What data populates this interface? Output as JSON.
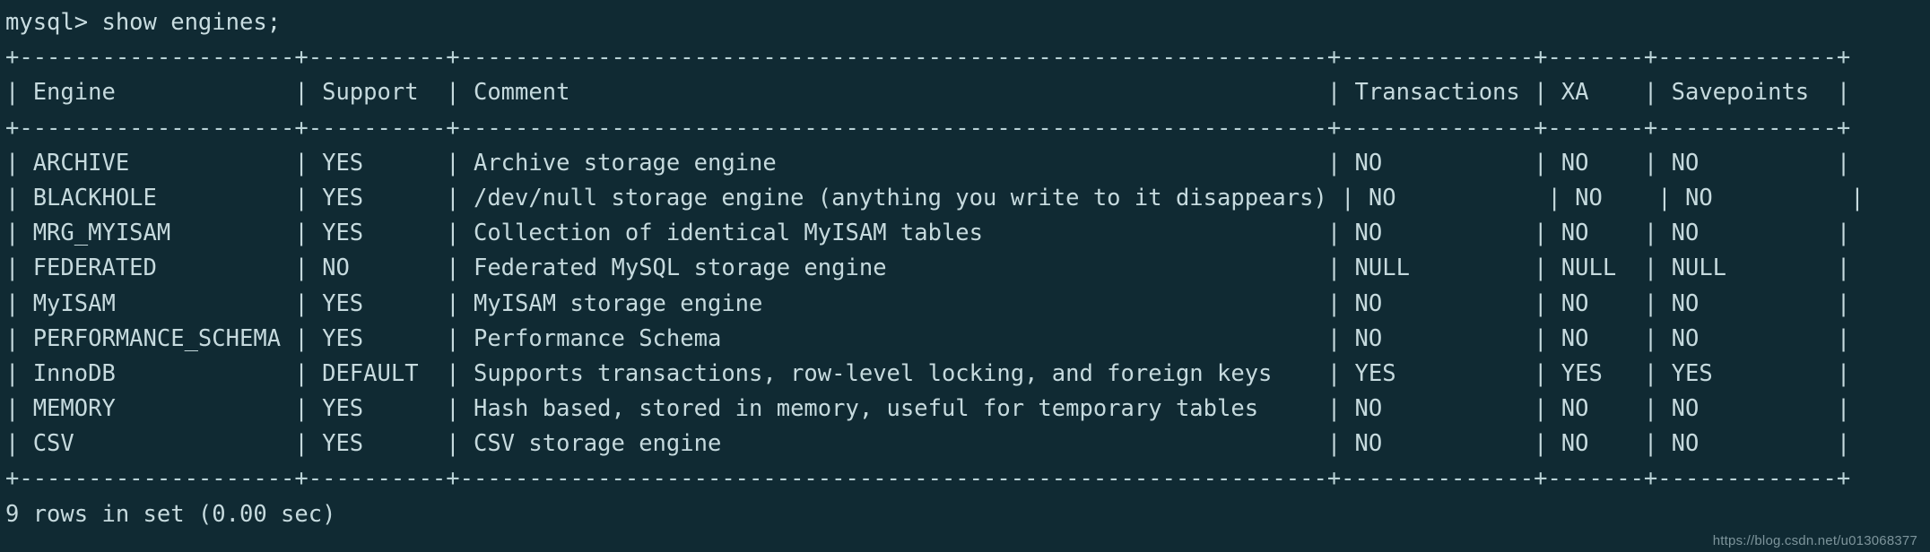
{
  "terminal": {
    "prompt": "mysql> ",
    "command": "show engines;",
    "prompt_line": "mysql> show engines;",
    "footer": "9 rows in set (0.00 sec)",
    "watermark": "https://blog.csdn.net/u013068377",
    "background_color": "#102a33",
    "text_color": "#c6dade",
    "rule_color": "#b9d2d6"
  },
  "table": {
    "columns": [
      {
        "name": "Engine",
        "width": 18
      },
      {
        "name": "Support",
        "width": 8
      },
      {
        "name": "Comment",
        "width": 61
      },
      {
        "name": "Transactions",
        "width": 12
      },
      {
        "name": "XA",
        "width": 5
      },
      {
        "name": "Savepoints",
        "width": 11
      }
    ],
    "headers": [
      "Engine",
      "Support",
      "Comment",
      "Transactions",
      "XA",
      "Savepoints"
    ],
    "rows": [
      {
        "Engine": "ARCHIVE",
        "Support": "YES",
        "Comment": "Archive storage engine",
        "Transactions": "NO",
        "XA": "NO",
        "Savepoints": "NO"
      },
      {
        "Engine": "BLACKHOLE",
        "Support": "YES",
        "Comment": "/dev/null storage engine (anything you write to it disappears)",
        "Transactions": "NO",
        "XA": "NO",
        "Savepoints": "NO"
      },
      {
        "Engine": "MRG_MYISAM",
        "Support": "YES",
        "Comment": "Collection of identical MyISAM tables",
        "Transactions": "NO",
        "XA": "NO",
        "Savepoints": "NO"
      },
      {
        "Engine": "FEDERATED",
        "Support": "NO",
        "Comment": "Federated MySQL storage engine",
        "Transactions": "NULL",
        "XA": "NULL",
        "Savepoints": "NULL"
      },
      {
        "Engine": "MyISAM",
        "Support": "YES",
        "Comment": "MyISAM storage engine",
        "Transactions": "NO",
        "XA": "NO",
        "Savepoints": "NO"
      },
      {
        "Engine": "PERFORMANCE_SCHEMA",
        "Support": "YES",
        "Comment": "Performance Schema",
        "Transactions": "NO",
        "XA": "NO",
        "Savepoints": "NO"
      },
      {
        "Engine": "InnoDB",
        "Support": "DEFAULT",
        "Comment": "Supports transactions, row-level locking, and foreign keys",
        "Transactions": "YES",
        "XA": "YES",
        "Savepoints": "YES"
      },
      {
        "Engine": "MEMORY",
        "Support": "YES",
        "Comment": "Hash based, stored in memory, useful for temporary tables",
        "Transactions": "NO",
        "XA": "NO",
        "Savepoints": "NO"
      },
      {
        "Engine": "CSV",
        "Support": "YES",
        "Comment": "CSV storage engine",
        "Transactions": "NO",
        "XA": "NO",
        "Savepoints": "NO"
      }
    ],
    "row_count": 9
  }
}
